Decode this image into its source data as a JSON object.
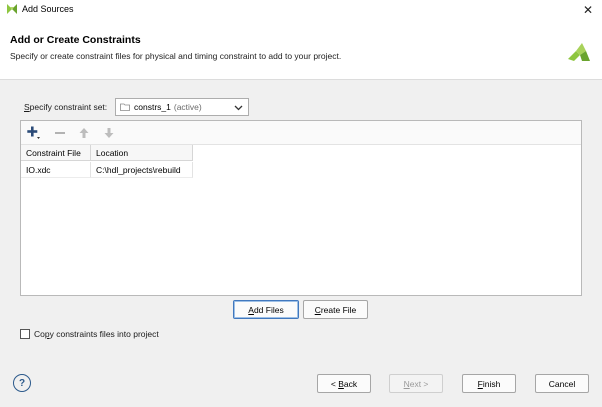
{
  "window": {
    "title": "Add Sources",
    "close_glyph": "✕"
  },
  "header": {
    "title": "Add or Create Constraints",
    "subtitle": "Specify or create constraint files for physical and timing constraint to add to your project."
  },
  "constraint_set": {
    "label_mnemonic": "S",
    "label_rest": "pecify constraint set:",
    "value": "constrs_1",
    "status": "(active)"
  },
  "table": {
    "columns": [
      "Constraint File",
      "Location"
    ],
    "rows": [
      {
        "file": "IO.xdc",
        "location": "C:\\hdl_projects\\rebuild"
      }
    ]
  },
  "file_buttons": {
    "add_files_mnemonic": "A",
    "add_files_rest": "dd Files",
    "create_file_mnemonic": "C",
    "create_file_rest": "reate File"
  },
  "copy_checkbox": {
    "checked": false,
    "label_pre": "Co",
    "label_mnemonic": "p",
    "label_rest": "y constraints files into project"
  },
  "help": {
    "glyph": "?"
  },
  "footer": {
    "back_pre": "< ",
    "back_mnemonic": "B",
    "back_rest": "ack",
    "next_mnemonic": "N",
    "next_rest": "ext >",
    "finish_mnemonic": "F",
    "finish_rest": "inish",
    "cancel": "Cancel"
  },
  "colors": {
    "accent": "#4178be",
    "logo_green": "#8ec63f"
  },
  "icons": {
    "app": "vivado-logo-icon",
    "add": "plus-icon",
    "remove": "minus-icon",
    "move_up": "arrow-up-icon",
    "move_down": "arrow-down-icon",
    "dropdown": "chevron-down-icon",
    "folder": "folder-icon",
    "help": "help-icon"
  }
}
